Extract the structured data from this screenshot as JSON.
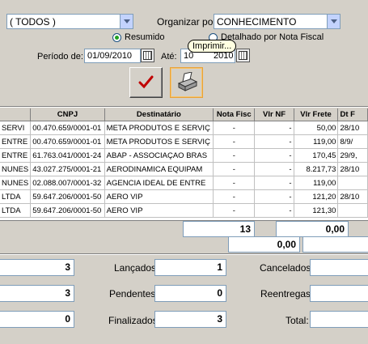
{
  "filters": {
    "category_value": "( TODOS )",
    "organize_label": "Organizar por:",
    "organize_value": "CONHECIMENTO",
    "radio_resumido": "Resumido",
    "radio_detalhado": "Detalhado por Nota Fiscal",
    "periodo_label": "Período de:",
    "date_from": "01/09/2010",
    "ate_label": "Até:",
    "date_to_left": "10",
    "date_to_right": "2010",
    "tooltip": "Imprimir..."
  },
  "grid": {
    "columns": [
      "",
      "CNPJ",
      "Destinatário",
      "Nota Fisc",
      "Vlr NF",
      "Vlr Frete",
      "Dt F"
    ],
    "rows": [
      [
        "SERVI",
        "00.470.659/0001-01",
        "META PRODUTOS E SERVIÇ",
        "-",
        "-",
        "50,00",
        "28/10"
      ],
      [
        "ENTRE",
        "00.470.659/0001-01",
        "META PRODUTOS E SERVIÇ",
        "-",
        "-",
        "119,00",
        "8/9/"
      ],
      [
        "ENTRE",
        "61.763.041/0001-24",
        "ABAP - ASSOCIAÇAO BRAS",
        "-",
        "-",
        "170,45",
        "29/9,"
      ],
      [
        "NUNES",
        "43.027.275/0001-21",
        "AERODINAMICA EQUIPAM",
        "-",
        "-",
        "8.217,73",
        "28/10"
      ],
      [
        "NUNES",
        "02.088.007/0001-32",
        "AGENCIA IDEAL DE ENTRE",
        "-",
        "-",
        "119,00",
        ""
      ],
      [
        "LTDA",
        "59.647.206/0001-50",
        "AERO VIP",
        "-",
        "-",
        "121,20",
        "28/10"
      ],
      [
        "LTDA",
        "59.647.206/0001-50",
        "AERO VIP",
        "-",
        "-",
        "121,30",
        ""
      ]
    ]
  },
  "totals": {
    "count": "13",
    "frete": "0,00",
    "nf": "0,00"
  },
  "summary": {
    "left1": "3",
    "left2": "3",
    "left3": "0",
    "lancados_label": "Lançados:",
    "lancados": "1",
    "pendentes_label": "Pendentes:",
    "pendentes": "0",
    "finalizados_label": "Finalizados:",
    "finalizados": "3",
    "cancelados_label": "Cancelados:",
    "reentregas_label": "Reentregas:",
    "total_label": "Total:"
  }
}
